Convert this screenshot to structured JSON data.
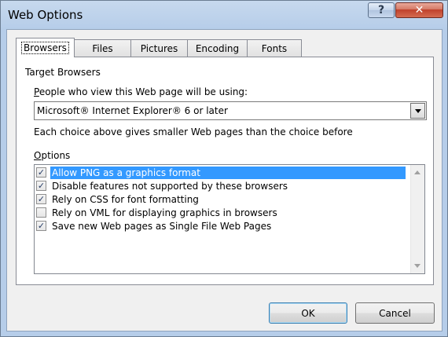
{
  "window": {
    "title": "Web Options",
    "help_glyph": "?",
    "close_glyph": "✕"
  },
  "tabs": [
    {
      "label": "Browsers",
      "active": true
    },
    {
      "label": "Files",
      "active": false
    },
    {
      "label": "Pictures",
      "active": false
    },
    {
      "label": "Encoding",
      "active": false
    },
    {
      "label": "Fonts",
      "active": false
    }
  ],
  "browsers": {
    "group_label": "Target Browsers",
    "people_label_ul": "P",
    "people_label_rest": "eople who view this Web page will be using:",
    "combo_value": "Microsoft® Internet Explorer® 6 or later",
    "hint": "Each choice above gives smaller Web pages than the choice before",
    "options_label_ul": "O",
    "options_label_rest": "ptions",
    "options": [
      {
        "label": "Allow PNG as a graphics format",
        "checked": true,
        "selected": true
      },
      {
        "label": "Disable features not supported by these browsers",
        "checked": true,
        "selected": false
      },
      {
        "label": "Rely on CSS for font formatting",
        "checked": true,
        "selected": false
      },
      {
        "label": "Rely on VML for displaying graphics in browsers",
        "checked": false,
        "selected": false
      },
      {
        "label": "Save new Web pages as Single File Web Pages",
        "checked": true,
        "selected": false
      }
    ]
  },
  "buttons": {
    "ok": "OK",
    "cancel": "Cancel"
  },
  "icons": {
    "checkmark": "✓"
  }
}
